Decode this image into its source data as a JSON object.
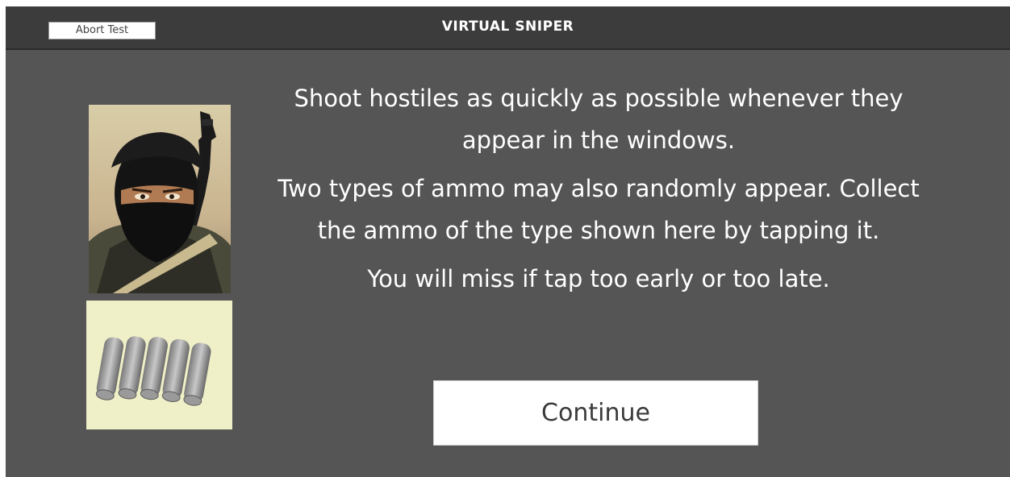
{
  "window": {
    "title": "VIRTUAL SNIPER",
    "abort_label": "Abort Test"
  },
  "images": {
    "hostile": "masked-gunman-portrait",
    "ammo": "bullet-cartridges"
  },
  "instructions": {
    "p1": "Shoot hostiles as quickly as possible whenever they appear in the windows.",
    "p2": "Two types of ammo may also randomly appear. Collect the ammo of the type shown here by tapping it.",
    "p3": "You will miss if tap too early or too late."
  },
  "continue_label": "Continue",
  "colors": {
    "panel": "#555555",
    "titlebar": "#3c3c3c",
    "text": "#ffffff",
    "ammo_card": "#f0f0c8"
  }
}
